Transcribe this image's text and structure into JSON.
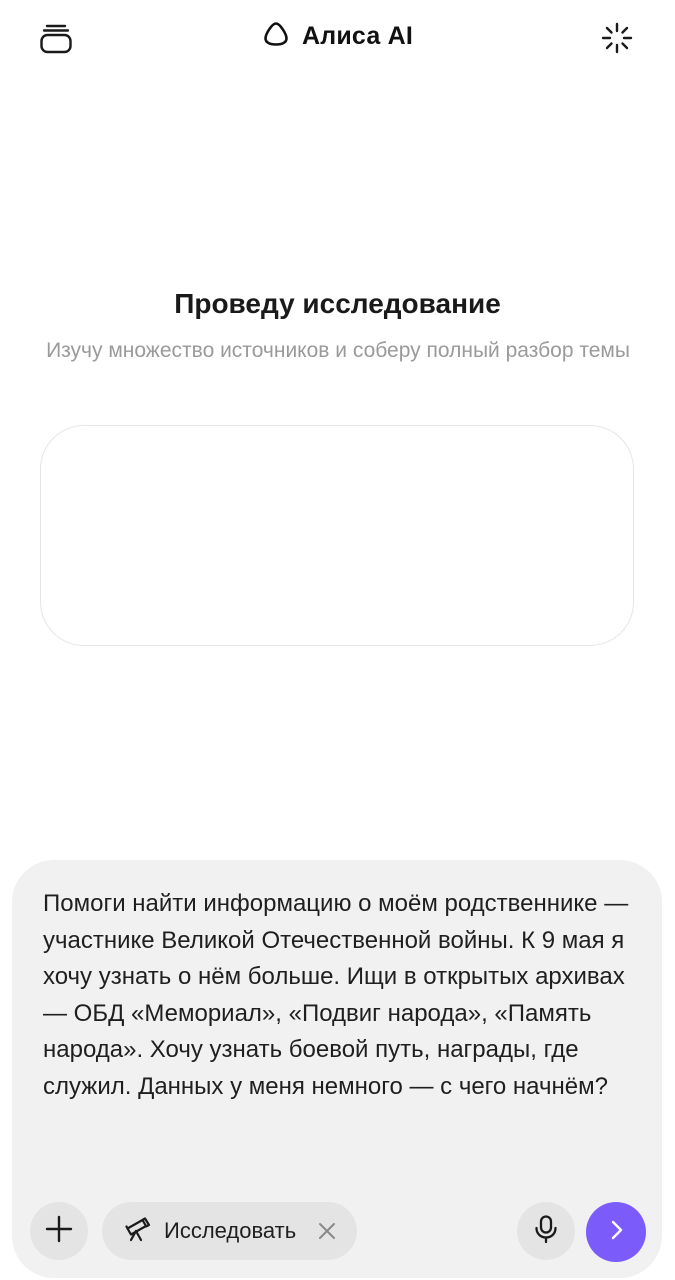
{
  "header": {
    "title": "Алиса AI",
    "left_icon": "chats-stack-icon",
    "right_icon": "sparkle-icon",
    "brand_icon": "alice-logo-icon"
  },
  "hero": {
    "title": "Проведу исследование",
    "subtitle": "Изучу множество источников и соберу полный разбор темы"
  },
  "composer": {
    "text": "Помоги найти информацию о моём родственнике — участнике Великой Отечественной войны. К 9 мая я хочу узнать о нём больше. Ищи в открытых архивах — ОБД «Мемориал», «Подвиг народа», «Память народа». Хочу узнать боевой путь, награды, где служил. Данных у меня немного — с чего начнём?",
    "mode_chip": {
      "label": "Исследовать",
      "icon": "telescope-icon"
    }
  },
  "colors": {
    "accent": "#7B5CFA",
    "composer_bg": "#F1F1F1",
    "button_bg": "#E4E4E4",
    "subtitle": "#9A9A9A"
  }
}
